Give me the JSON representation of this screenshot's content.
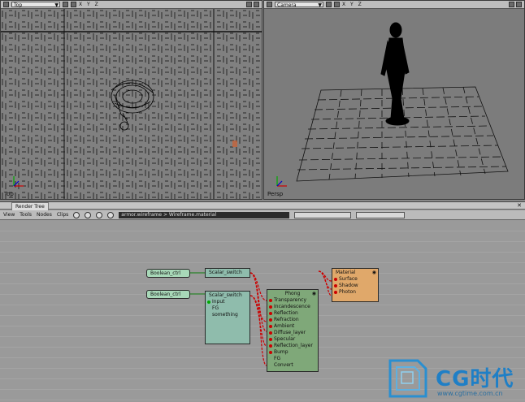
{
  "viewport_top": {
    "view_name": "Top",
    "axes": "X Y Z",
    "label": "Top",
    "icons": [
      "camera-icon",
      "light-icon",
      "display-icon",
      "maximize-icon"
    ]
  },
  "viewport_camera": {
    "view_name": "Camera",
    "axes": "X Y Z",
    "label": "Persp",
    "icons": [
      "camera-icon",
      "light-icon",
      "display-icon",
      "maximize-icon"
    ]
  },
  "render_tree": {
    "title": "Render Tree",
    "menu": [
      "View",
      "Tools",
      "Nodes",
      "Clips"
    ],
    "path": "armor.wireframe > Wireframe.material",
    "nodes": {
      "boolean1": {
        "title": "Boolean_ctrl"
      },
      "boolean2": {
        "title": "Boolean_ctrl"
      },
      "switch1": {
        "title": "Scalar_switch"
      },
      "switch2": {
        "title": "Scalar_switch",
        "params": [
          "Input",
          "FG",
          "something"
        ]
      },
      "phong": {
        "title": "Phong",
        "params": [
          "Transparency",
          "Incandescence",
          "Reflection",
          "Refraction",
          "Ambient",
          "Diffuse_layer",
          "Specular",
          "Reflection_layer",
          "Bump"
        ],
        "footer": [
          "FG",
          "Convert"
        ]
      },
      "material": {
        "title": "Material",
        "params": [
          "Surface",
          "Shadow",
          "Photon"
        ]
      }
    }
  },
  "watermark": {
    "brand": "CG时代",
    "url": "www.cgtime.com.cn"
  },
  "colors": {
    "node_green": "#7fa879",
    "node_teal": "#8fbcac",
    "node_orange": "#e0a86a",
    "node_bool": "#a8d8b8",
    "wire_red": "#cc0000"
  }
}
